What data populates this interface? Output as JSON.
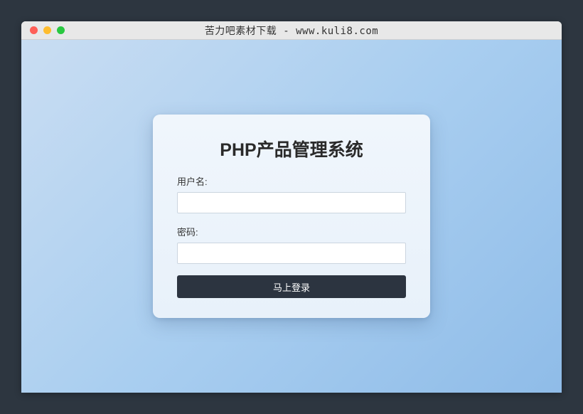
{
  "window": {
    "title": "苦力吧素材下载 - www.kuli8.com"
  },
  "login": {
    "title": "PHP产品管理系统",
    "username_label": "用户名:",
    "username_value": "",
    "password_label": "密码:",
    "password_value": "",
    "submit_label": "马上登录"
  }
}
